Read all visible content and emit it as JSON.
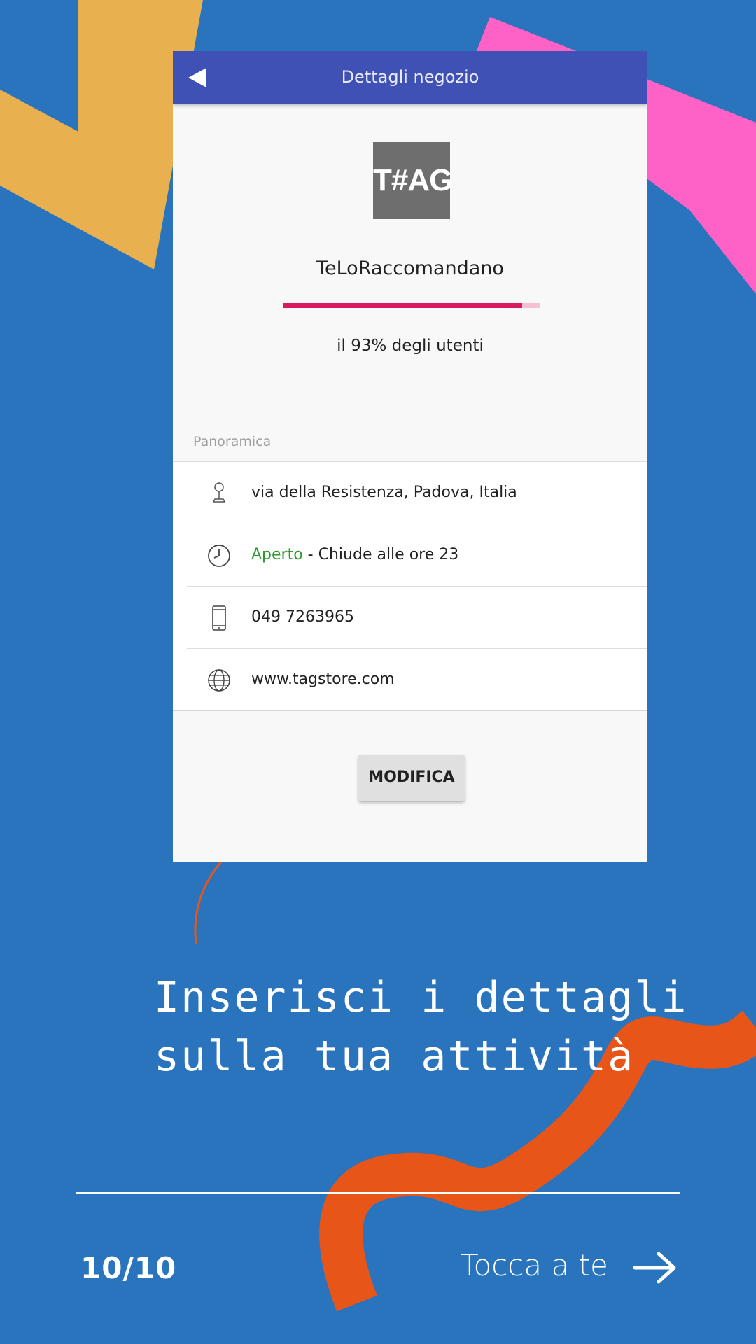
{
  "app": {
    "title": "Dettagli negozio",
    "logo_text": "T#AG",
    "store_name": "TeLoRaccomandano",
    "rating_fraction": 0.93,
    "rating_text": "il 93% degli utenti",
    "section_label": "Panoramica",
    "address": "via della Resistenza, Padova, Italia",
    "hours_status": "Aperto",
    "hours_detail": " - Chiude alle ore 23",
    "phone": "049 7263965",
    "website": "www.tagstore.com",
    "edit_button": "MODIFICA"
  },
  "slide": {
    "headline": "Inserisci i dettagli\nsulla tua attività",
    "page_number": "10/10",
    "cta": "Tocca a te"
  },
  "colors": {
    "background": "#2a74bd",
    "app_bar": "#3f51b5",
    "progress": "#d81b60",
    "open_status": "#2e9a2e",
    "accent_orange": "#e85518",
    "accent_yellow": "#e9b04f",
    "accent_pink": "#ff62c7"
  },
  "icons": [
    "back-arrow-icon",
    "location-pin-icon",
    "clock-icon",
    "smartphone-icon",
    "globe-icon",
    "arrow-right-icon"
  ]
}
